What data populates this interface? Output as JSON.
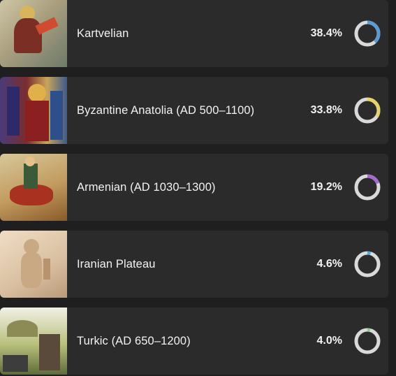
{
  "rows": [
    {
      "label": "Kartvelian",
      "percent": "38.4%",
      "fraction": 0.384,
      "color": "#5b9bd5",
      "image": "saint-figure-fresco"
    },
    {
      "label": "Byzantine Anatolia (AD 500–1100)",
      "percent": "33.8%",
      "fraction": 0.338,
      "color": "#e8d26a",
      "image": "byzantine-court-scene"
    },
    {
      "label": "Armenian (AD 1030–1300)",
      "percent": "19.2%",
      "fraction": 0.192,
      "color": "#a66bd1",
      "image": "armenian-rider-manuscript"
    },
    {
      "label": "Iranian Plateau",
      "percent": "4.6%",
      "fraction": 0.046,
      "color": "#5ba8d6",
      "image": "clay-seal-relief"
    },
    {
      "label": "Turkic (AD 650–1200)",
      "percent": "4.0%",
      "fraction": 0.04,
      "color": "#8fc99a",
      "image": "nomadic-camp-scene"
    }
  ],
  "donut_track_color": "#d9d9d9"
}
